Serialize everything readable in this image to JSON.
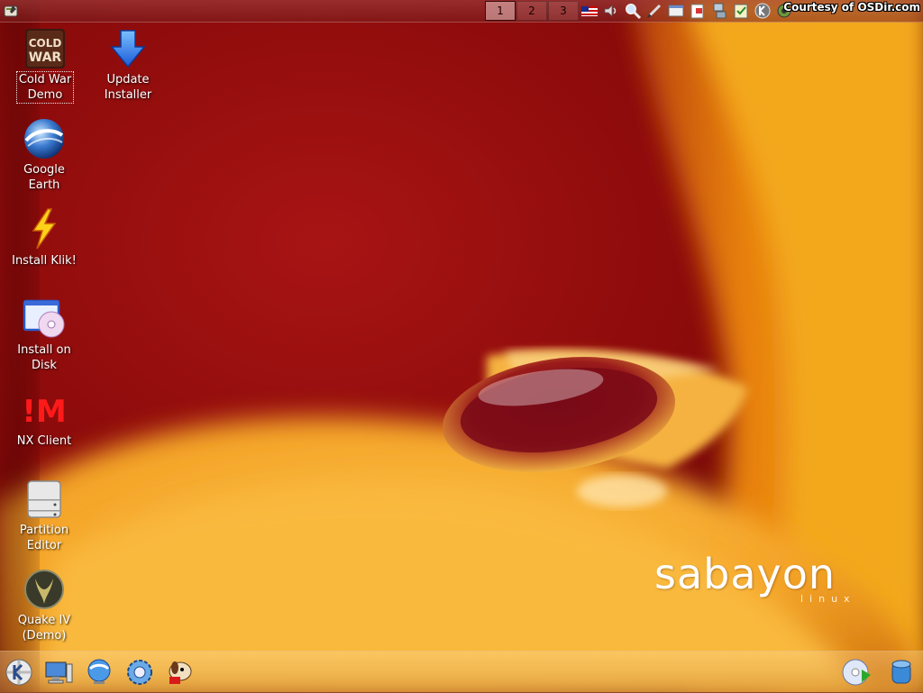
{
  "top_panel": {
    "pager": [
      "1",
      "2",
      "3"
    ],
    "active_desktop": "1",
    "courtesy": "Courtesy of OSDir.com",
    "tray_icons": [
      "us-flag-icon",
      "volume-icon",
      "magnifier-icon",
      "pen-icon",
      "window-icon",
      "notes-icon",
      "network-icon",
      "clipboard-icon",
      "kde-k-icon",
      "updater-icon"
    ]
  },
  "desktop": {
    "icons": [
      {
        "label": "Cold War\nDemo",
        "icon": "cold-war-icon",
        "selected": true
      },
      {
        "label": "Update\nInstaller",
        "icon": "download-arrow-icon"
      },
      {
        "label": "Google\nEarth",
        "icon": "google-earth-icon"
      },
      {
        "label": "Install Klik!",
        "icon": "lightning-icon"
      },
      {
        "label": "Install on\nDisk",
        "icon": "install-disk-icon"
      },
      {
        "label": "NX Client",
        "icon": "nx-icon"
      },
      {
        "label": "Partition\nEditor",
        "icon": "hard-drive-icon"
      },
      {
        "label": "Quake IV\n(Demo)",
        "icon": "quake-icon"
      }
    ],
    "coldwar_text_1": "COLD",
    "coldwar_text_2": "WAR",
    "nx_text": "!M"
  },
  "wallpaper": {
    "logo": "sabayon",
    "logo_sub": "linux",
    "colors": {
      "red_dark": "#5a0606",
      "red": "#a81414",
      "orange": "#f29a1a",
      "yellow": "#f7b838"
    }
  },
  "bottom_panel": {
    "left_buttons": [
      "kde-menu-icon",
      "desktop-computer-icon",
      "konqueror-globe-icon",
      "system-settings-icon",
      "kaffeine-dog-icon"
    ],
    "right_buttons": [
      "dvd-icon",
      "storage-icon"
    ]
  }
}
